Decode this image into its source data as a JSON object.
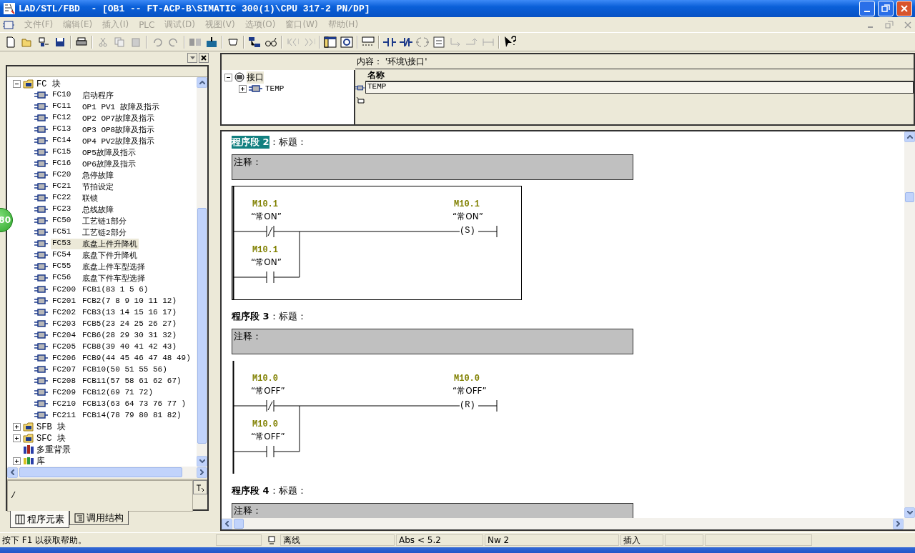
{
  "window": {
    "title": "LAD/STL/FBD  - [OB1 -- FT-ACP-B\\SIMATIC 300(1)\\CPU 317-2 PN/DP]"
  },
  "menu": [
    {
      "label": "文件(F)",
      "disabled": true
    },
    {
      "label": "编辑(E)",
      "disabled": true
    },
    {
      "label": "插入(I)",
      "disabled": true
    },
    {
      "label": "PLC",
      "disabled": true
    },
    {
      "label": "调试(D)",
      "disabled": true
    },
    {
      "label": "视图(V)",
      "disabled": true
    },
    {
      "label": "选项(O)",
      "disabled": true
    },
    {
      "label": "窗口(W)",
      "disabled": true
    },
    {
      "label": "帮助(H)",
      "disabled": true
    }
  ],
  "floating_badge": "80",
  "tree": [
    {
      "label": "FC 块",
      "expanded": true,
      "children": [
        {
          "label": "FC10",
          "description": "启动程序",
          "selected": false
        },
        {
          "label": "FC11",
          "description": "OP1 PV1 故障及指示",
          "selected": false
        },
        {
          "label": "FC12",
          "description": "OP2 OP7故障及指示",
          "selected": false
        },
        {
          "label": "FC13",
          "description": "OP3 OP8故障及指示",
          "selected": false
        },
        {
          "label": "FC14",
          "description": "OP4 PV2故障及指示",
          "selected": false
        },
        {
          "label": "FC15",
          "description": "OP5故障及指示",
          "selected": false
        },
        {
          "label": "FC16",
          "description": "OP6故障及指示",
          "selected": false
        },
        {
          "label": "FC20",
          "description": "急停故障",
          "selected": false
        },
        {
          "label": "FC21",
          "description": "节拍设定",
          "selected": false
        },
        {
          "label": "FC22",
          "description": "联锁",
          "selected": false
        },
        {
          "label": "FC23",
          "description": "总线故障",
          "selected": false
        },
        {
          "label": "FC50",
          "description": "工艺链1部分",
          "selected": false
        },
        {
          "label": "FC51",
          "description": "工艺链2部分",
          "selected": false
        },
        {
          "label": "FC53",
          "description": "底盘上件升降机",
          "selected": true
        },
        {
          "label": "FC54",
          "description": "底盘下件升降机",
          "selected": false
        },
        {
          "label": "FC55",
          "description": "底盘上件车型选择",
          "selected": false
        },
        {
          "label": "FC56",
          "description": "底盘下件车型选择",
          "selected": false
        },
        {
          "label": "FC200",
          "description": "FCB1(83 1 5 6)",
          "selected": false
        },
        {
          "label": "FC201",
          "description": "FCB2(7 8 9 10 11 12)",
          "selected": false
        },
        {
          "label": "FC202",
          "description": "FCB3(13 14 15 16 17)",
          "selected": false
        },
        {
          "label": "FC203",
          "description": "FCB5(23 24 25 26 27)",
          "selected": false
        },
        {
          "label": "FC204",
          "description": "FCB6(28 29 30 31 32)",
          "selected": false
        },
        {
          "label": "FC205",
          "description": "FCB8(39 40 41 42 43)",
          "selected": false
        },
        {
          "label": "FC206",
          "description": "FCB9(44 45 46 47 48 49)",
          "selected": false
        },
        {
          "label": "FC207",
          "description": "FCB10(50 51 55 56)",
          "selected": false
        },
        {
          "label": "FC208",
          "description": "FCB11(57 58 61 62 67)",
          "selected": false
        },
        {
          "label": "FC209",
          "description": "FCB12(69 71 72)",
          "selected": false
        },
        {
          "label": "FC210",
          "description": "FCB13(63 64 73 76 77 )",
          "selected": false
        },
        {
          "label": "FC211",
          "description": "FCB14(78 79 80 81 82)",
          "selected": false
        }
      ]
    },
    {
      "label": "SFB 块",
      "expanded": false,
      "kind": "folder"
    },
    {
      "label": "SFC 块",
      "expanded": false,
      "kind": "folder"
    },
    {
      "label": "多重背景",
      "kind": "multi"
    },
    {
      "label": "库",
      "expanded": false,
      "kind": "library"
    }
  ],
  "path_field": {
    "value": "/"
  },
  "left_tabs": [
    {
      "label": "程序元素",
      "selected": true
    },
    {
      "label": "调用结构",
      "selected": false
    }
  ],
  "interface": {
    "tree": {
      "label": "接口",
      "expanded": true,
      "children": [
        {
          "label": "TEMP",
          "expanded": false
        }
      ]
    },
    "content_label": "内容： '环境\\接口'",
    "column": "名称",
    "rows": [
      "TEMP"
    ]
  },
  "networks": [
    {
      "title": "程序段 2",
      "suffix": "：标题：",
      "selected": true,
      "comment": "注释：",
      "contacts": [
        {
          "kind": "nc",
          "address": "M10.1",
          "symbol": "“常ON”"
        },
        {
          "kind": "no",
          "address": "M10.1",
          "symbol": "“常ON”"
        }
      ],
      "coil": {
        "address": "M10.1",
        "symbol": "“常ON”",
        "text": "(S)"
      }
    },
    {
      "title": "程序段 3",
      "suffix": "：标题：",
      "selected": false,
      "comment": "注释：",
      "contacts": [
        {
          "kind": "nc",
          "address": "M10.0",
          "symbol": "“常OFF”"
        },
        {
          "kind": "no",
          "address": "M10.0",
          "symbol": "“常OFF”"
        }
      ],
      "coil": {
        "address": "M10.0",
        "symbol": "“常OFF”",
        "text": "(R)"
      }
    },
    {
      "title": "程序段 4",
      "suffix": "：标题：",
      "selected": false,
      "comment": "注释："
    }
  ],
  "status_bar": {
    "help": "按下 F1 以获取帮助。",
    "mode": "离线",
    "address": "Abs < 5.2",
    "network": "Nw 2",
    "insert": "插入"
  }
}
